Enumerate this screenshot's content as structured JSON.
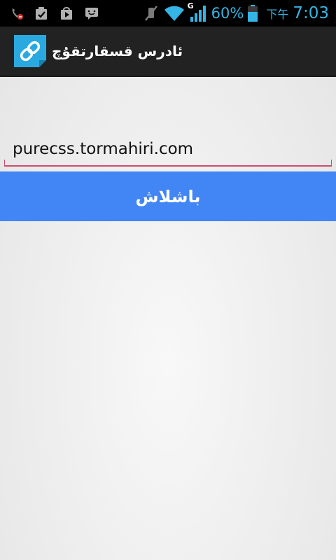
{
  "status_bar": {
    "battery_percent": "60%",
    "ampm": "下午",
    "time": "7:03",
    "network_type": "G",
    "icons": [
      "missed-call-icon",
      "task-check-icon",
      "play-store-icon",
      "chat-message-icon",
      "mute-icon",
      "wifi-icon",
      "signal-icon",
      "battery-icon"
    ],
    "color": "#34b5e5"
  },
  "action_bar": {
    "title": "ئادرس قسقارتقۇچ",
    "icon": "link-icon",
    "icon_color": "#2aa9e0"
  },
  "url_input": {
    "value": "purecss.tormahiri.com",
    "underline_color": "#cc4d6e"
  },
  "submit_button": {
    "label": "باشلاش",
    "color": "#4285f4"
  }
}
